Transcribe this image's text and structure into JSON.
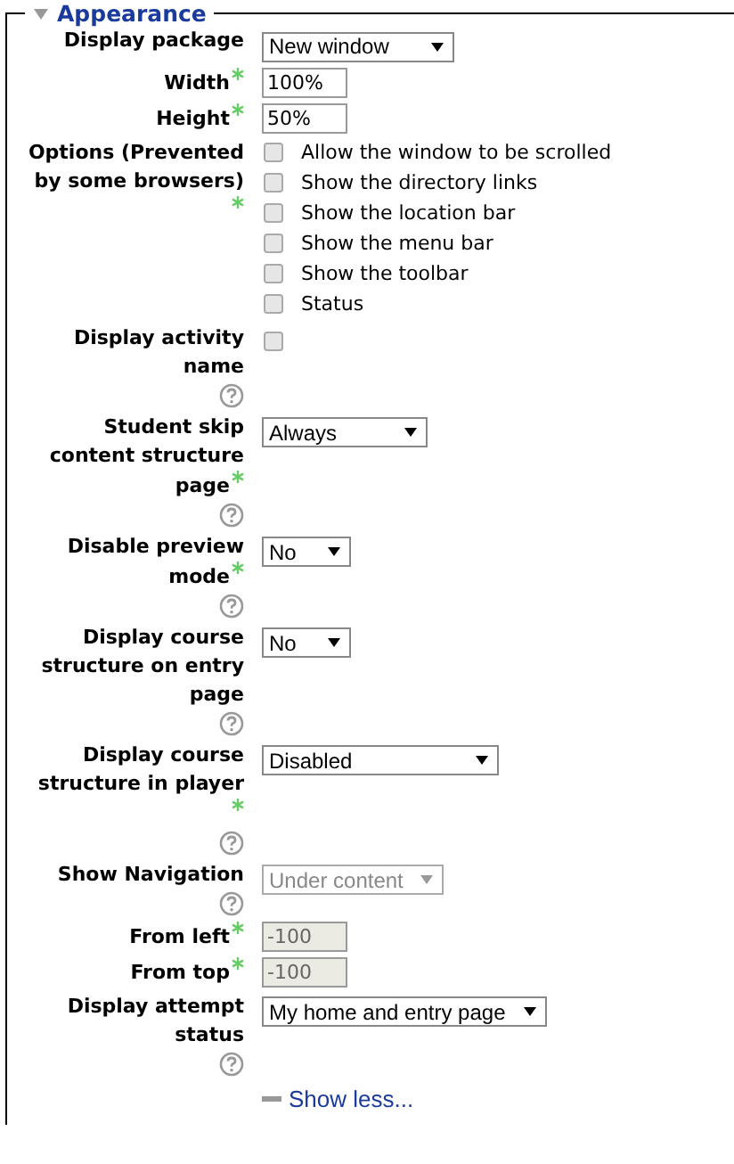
{
  "section": {
    "title": "Appearance",
    "expanded": true
  },
  "fields": [
    {
      "label": "Display package",
      "required": false,
      "help": false,
      "kind": "select",
      "value": "New window",
      "disabled": false
    },
    {
      "label": "Width",
      "required": true,
      "help": false,
      "kind": "text",
      "value": "100%",
      "disabled": false
    },
    {
      "label": "Height",
      "required": true,
      "help": false,
      "kind": "text",
      "value": "50%",
      "disabled": false
    },
    {
      "label": "Options (Prevented by some browsers)",
      "required": true,
      "help": false,
      "kind": "checkboxes",
      "options": [
        {
          "label": "Allow the window to be scrolled",
          "checked": false
        },
        {
          "label": "Show the directory links",
          "checked": false
        },
        {
          "label": "Show the location bar",
          "checked": false
        },
        {
          "label": "Show the menu bar",
          "checked": false
        },
        {
          "label": "Show the toolbar",
          "checked": false
        },
        {
          "label": "Status",
          "checked": false
        }
      ]
    },
    {
      "label": "Display activity name",
      "required": false,
      "help": true,
      "kind": "checkbox",
      "checked": false
    },
    {
      "label": "Student skip content structure page",
      "required": true,
      "help": true,
      "kind": "select",
      "value": "Always",
      "disabled": false
    },
    {
      "label": "Disable preview mode",
      "required": true,
      "help": true,
      "kind": "select",
      "value": "No",
      "disabled": false
    },
    {
      "label": "Display course structure on entry page",
      "required": false,
      "help": true,
      "kind": "select",
      "value": "No",
      "disabled": false
    },
    {
      "label": "Display course structure in player",
      "required": true,
      "help": true,
      "kind": "select",
      "value": "Disabled",
      "disabled": false
    },
    {
      "label": "Show Navigation",
      "required": false,
      "help": true,
      "kind": "select",
      "value": "Under content",
      "disabled": true
    },
    {
      "label": "From left",
      "required": true,
      "help": false,
      "kind": "text",
      "value": "-100",
      "disabled": true
    },
    {
      "label": "From top",
      "required": true,
      "help": false,
      "kind": "text",
      "value": "-100",
      "disabled": true
    },
    {
      "label": "Display attempt status",
      "required": false,
      "help": true,
      "kind": "select",
      "value": "My home and entry page",
      "disabled": false
    }
  ],
  "show_less": "Show less..."
}
